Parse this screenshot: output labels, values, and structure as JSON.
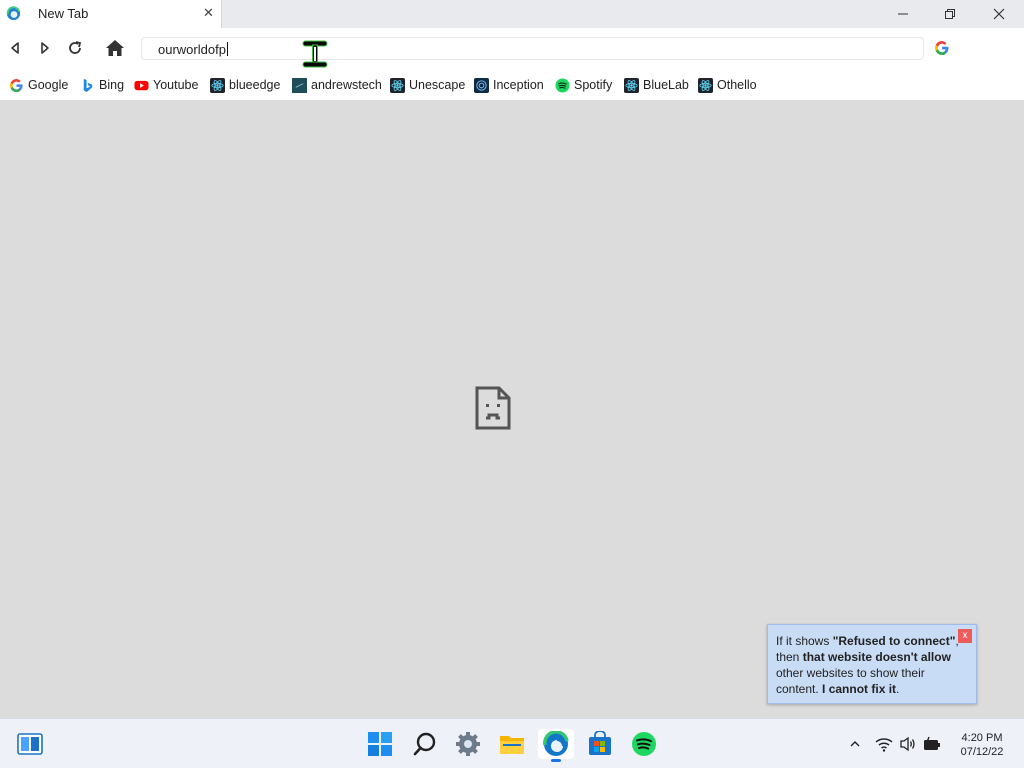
{
  "browser": {
    "tab": {
      "title": "New Tab"
    },
    "address_bar": {
      "value": "ourworldofp"
    },
    "bookmarks": [
      {
        "label": "Google",
        "icon": "google-icon"
      },
      {
        "label": "Bing",
        "icon": "bing-icon"
      },
      {
        "label": "Youtube",
        "icon": "youtube-icon"
      },
      {
        "label": "blueedge",
        "icon": "react-icon"
      },
      {
        "label": "andrewstech",
        "icon": "andrewstech-icon"
      },
      {
        "label": "Unescape",
        "icon": "react-icon"
      },
      {
        "label": "Inception",
        "icon": "inception-icon"
      },
      {
        "label": "Spotify",
        "icon": "spotify-icon"
      },
      {
        "label": "BlueLab",
        "icon": "react-icon"
      },
      {
        "label": "Othello",
        "icon": "react-icon"
      }
    ]
  },
  "page": {
    "error_icon": "sad-document-icon"
  },
  "tooltip": {
    "close_label": "x",
    "parts": [
      "If it shows ",
      "\"Refused to connect\"",
      ", then ",
      "that website doesn't allow",
      " other websites to show their content. ",
      "I cannot fix it",
      "."
    ]
  },
  "taskbar": {
    "apps": [
      "widgets-icon",
      "windows-start-icon",
      "search-icon",
      "settings-icon",
      "file-explorer-icon",
      "edge-icon",
      "microsoft-store-icon",
      "spotify-icon"
    ],
    "clock": {
      "time": "4:20 PM",
      "date": "07/12/22"
    }
  }
}
